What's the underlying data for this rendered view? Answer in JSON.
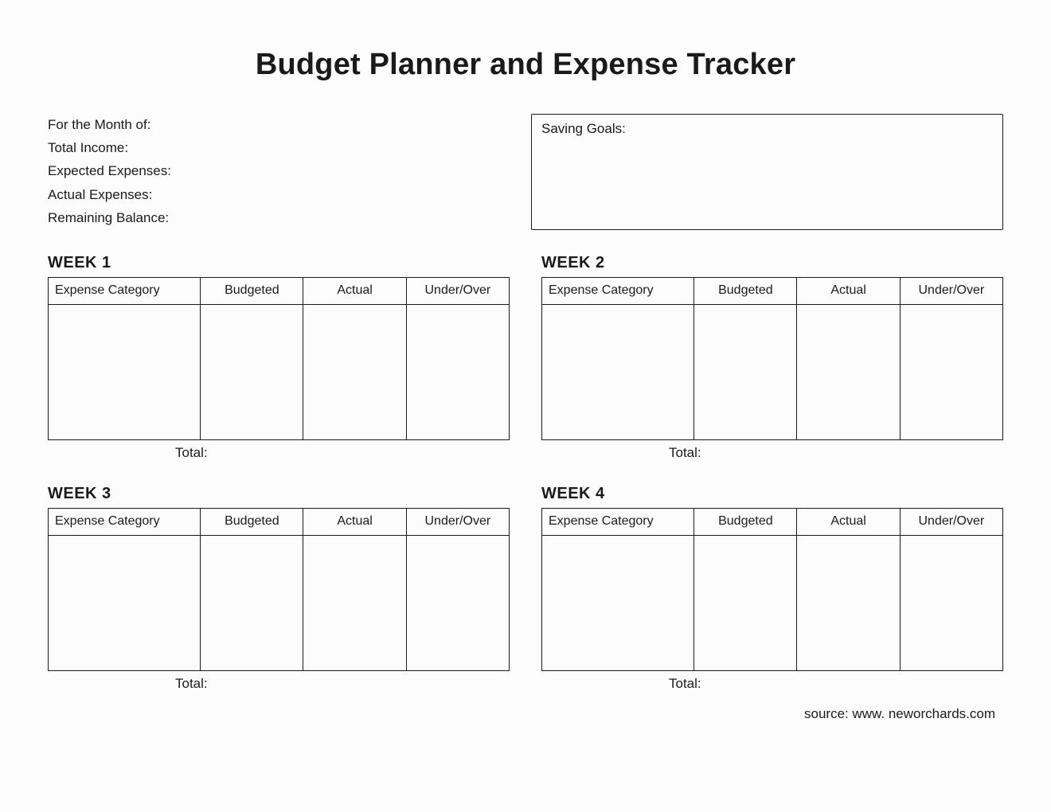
{
  "title": "Budget Planner and Expense Tracker",
  "info": {
    "month_label": "For the Month of:",
    "income_label": "Total Income:",
    "expected_label": "Expected Expenses:",
    "actual_label": "Actual Expenses:",
    "balance_label": "Remaining Balance:"
  },
  "goals_label": "Saving Goals:",
  "columns": {
    "category": "Expense Category",
    "budgeted": "Budgeted",
    "actual": "Actual",
    "underover": "Under/Over"
  },
  "total_label": "Total:",
  "weeks": [
    {
      "title": "WEEK 1"
    },
    {
      "title": "WEEK 2"
    },
    {
      "title": "WEEK 3"
    },
    {
      "title": "WEEK 4"
    }
  ],
  "source": "source: www. neworchards.com"
}
